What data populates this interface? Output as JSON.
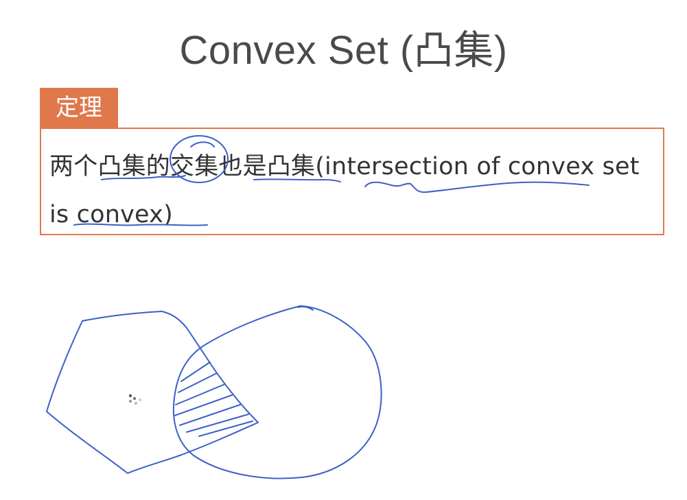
{
  "slide": {
    "title": "Convex Set (凸集)"
  },
  "theorem": {
    "tag": "定理",
    "text": "两个凸集的交集也是凸集(intersection of convex set is convex)"
  },
  "colors": {
    "accent": "#e0784b",
    "ink": "#3a5fc8",
    "title_text": "#4a4a4a",
    "body_text": "#333333"
  },
  "annotations": {
    "figure": "hand-drawn convex polygon overlapping a circle with the intersection region hatched",
    "underlines": [
      "凸集",
      "交集 (circled)",
      "凸集",
      "intersection of convex",
      "set is convex"
    ]
  }
}
